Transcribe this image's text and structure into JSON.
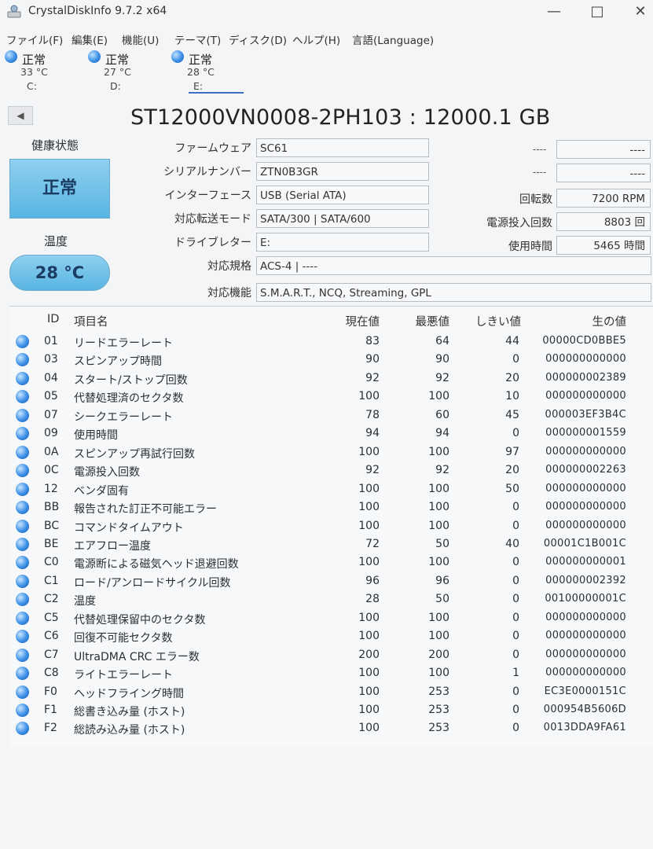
{
  "window": {
    "title": "CrystalDiskInfo 9.7.2 x64",
    "minimize": "—",
    "maximize": "□",
    "close": "✕"
  },
  "menu": [
    "ファイル(F)",
    "編集(E)",
    "機能(U)",
    "テーマ(T)",
    "ディスク(D)",
    "ヘルプ(H)",
    "言語(Language)"
  ],
  "drives": [
    {
      "status": "正常",
      "temp": "33 °C",
      "letter": "C:"
    },
    {
      "status": "正常",
      "temp": "27 °C",
      "letter": "D:"
    },
    {
      "status": "正常",
      "temp": "28 °C",
      "letter": "E:"
    }
  ],
  "model": "ST12000VN0008-2PH103 : 12000.1 GB",
  "health": {
    "label": "健康状態",
    "value": "正常"
  },
  "temperature": {
    "label": "温度",
    "value": "28 °C"
  },
  "info": {
    "firmware_label": "ファームウェア",
    "firmware": "SC61",
    "serial_label": "シリアルナンバー",
    "serial": "ZTN0B3GR",
    "interface_label": "インターフェース",
    "interface": "USB (Serial ATA)",
    "transfer_label": "対応転送モード",
    "transfer": "SATA/300 | SATA/600",
    "letter_label": "ドライブレター",
    "letter": "E:",
    "standard_label": "対応規格",
    "standard": "ACS-4 | ----",
    "features_label": "対応機能",
    "features": "S.M.A.R.T., NCQ, Streaming, GPL",
    "dash1": "----",
    "dash2": "----",
    "dash3": "----",
    "dash4": "----",
    "rotation_label": "回転数",
    "rotation": "7200 RPM",
    "power_count_label": "電源投入回数",
    "power_count": "8803 回",
    "hours_label": "使用時間",
    "hours": "5465 時間"
  },
  "smart_headers": {
    "id": "ID",
    "name": "項目名",
    "current": "現在値",
    "worst": "最悪値",
    "threshold": "しきい値",
    "raw": "生の値"
  },
  "smart_rows": [
    {
      "id": "01",
      "name": "リードエラーレート",
      "current": "83",
      "worst": "64",
      "threshold": "44",
      "raw": "00000CD0BBE5"
    },
    {
      "id": "03",
      "name": "スピンアップ時間",
      "current": "90",
      "worst": "90",
      "threshold": "0",
      "raw": "000000000000"
    },
    {
      "id": "04",
      "name": "スタート/ストップ回数",
      "current": "92",
      "worst": "92",
      "threshold": "20",
      "raw": "000000002389"
    },
    {
      "id": "05",
      "name": "代替処理済のセクタ数",
      "current": "100",
      "worst": "100",
      "threshold": "10",
      "raw": "000000000000"
    },
    {
      "id": "07",
      "name": "シークエラーレート",
      "current": "78",
      "worst": "60",
      "threshold": "45",
      "raw": "000003EF3B4C"
    },
    {
      "id": "09",
      "name": "使用時間",
      "current": "94",
      "worst": "94",
      "threshold": "0",
      "raw": "000000001559"
    },
    {
      "id": "0A",
      "name": "スピンアップ再試行回数",
      "current": "100",
      "worst": "100",
      "threshold": "97",
      "raw": "000000000000"
    },
    {
      "id": "0C",
      "name": "電源投入回数",
      "current": "92",
      "worst": "92",
      "threshold": "20",
      "raw": "000000002263"
    },
    {
      "id": "12",
      "name": "ベンダ固有",
      "current": "100",
      "worst": "100",
      "threshold": "50",
      "raw": "000000000000"
    },
    {
      "id": "BB",
      "name": "報告された訂正不可能エラー",
      "current": "100",
      "worst": "100",
      "threshold": "0",
      "raw": "000000000000"
    },
    {
      "id": "BC",
      "name": "コマンドタイムアウト",
      "current": "100",
      "worst": "100",
      "threshold": "0",
      "raw": "000000000000"
    },
    {
      "id": "BE",
      "name": "エアフロー温度",
      "current": "72",
      "worst": "50",
      "threshold": "40",
      "raw": "00001C1B001C"
    },
    {
      "id": "C0",
      "name": "電源断による磁気ヘッド退避回数",
      "current": "100",
      "worst": "100",
      "threshold": "0",
      "raw": "000000000001"
    },
    {
      "id": "C1",
      "name": "ロード/アンロードサイクル回数",
      "current": "96",
      "worst": "96",
      "threshold": "0",
      "raw": "000000002392"
    },
    {
      "id": "C2",
      "name": "温度",
      "current": "28",
      "worst": "50",
      "threshold": "0",
      "raw": "00100000001C"
    },
    {
      "id": "C5",
      "name": "代替処理保留中のセクタ数",
      "current": "100",
      "worst": "100",
      "threshold": "0",
      "raw": "000000000000"
    },
    {
      "id": "C6",
      "name": "回復不可能セクタ数",
      "current": "100",
      "worst": "100",
      "threshold": "0",
      "raw": "000000000000"
    },
    {
      "id": "C7",
      "name": "UltraDMA CRC エラー数",
      "current": "200",
      "worst": "200",
      "threshold": "0",
      "raw": "000000000000"
    },
    {
      "id": "C8",
      "name": "ライトエラーレート",
      "current": "100",
      "worst": "100",
      "threshold": "1",
      "raw": "000000000000"
    },
    {
      "id": "F0",
      "name": "ヘッドフライング時間",
      "current": "100",
      "worst": "253",
      "threshold": "0",
      "raw": "EC3E0000151C"
    },
    {
      "id": "F1",
      "name": "総書き込み量 (ホスト)",
      "current": "100",
      "worst": "253",
      "threshold": "0",
      "raw": "000954B5606D"
    },
    {
      "id": "F2",
      "name": "総読み込み量 (ホスト)",
      "current": "100",
      "worst": "253",
      "threshold": "0",
      "raw": "0013DDA9FA61"
    }
  ]
}
